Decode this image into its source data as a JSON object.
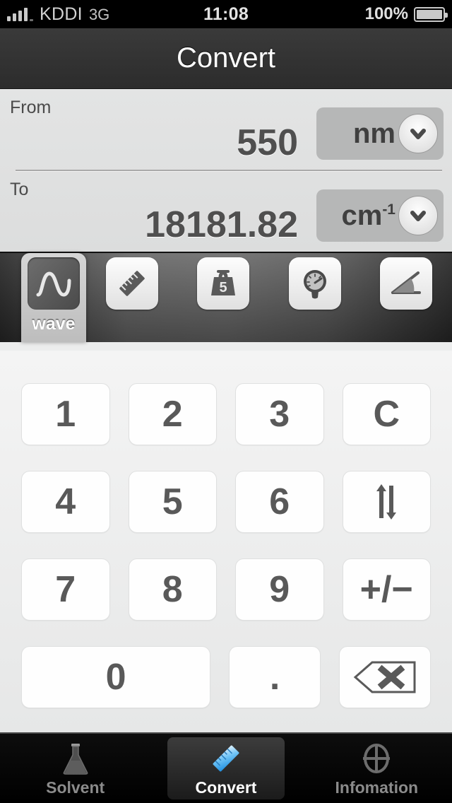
{
  "status_bar": {
    "carrier": "KDDI",
    "network": "3G",
    "time": "11:08",
    "battery_percent": "100%",
    "signal_icon": "signal-bars-icon",
    "battery_icon": "battery-full-icon"
  },
  "navbar": {
    "title": "Convert"
  },
  "converter": {
    "from": {
      "label": "From",
      "value": "550",
      "unit": "nm",
      "unit_superscript": "",
      "dropdown_icon": "chevron-down-icon"
    },
    "to": {
      "label": "To",
      "value": "18181.82",
      "unit": "cm",
      "unit_superscript": "-1",
      "dropdown_icon": "chevron-down-icon"
    }
  },
  "categories": {
    "selected": "wave",
    "items": [
      {
        "label": "wave",
        "icon": "sine-wave-icon",
        "selected": true
      },
      {
        "label": "length",
        "icon": "ruler-icon",
        "selected": false
      },
      {
        "label": "weight",
        "icon": "weight-5-icon",
        "selected": false
      },
      {
        "label": "pressure",
        "icon": "pressure-gauge-icon",
        "selected": false
      },
      {
        "label": "angle",
        "icon": "angle-icon",
        "selected": false
      }
    ]
  },
  "keypad": {
    "rows": [
      [
        {
          "label": "1",
          "name": "key-1",
          "icon": ""
        },
        {
          "label": "2",
          "name": "key-2",
          "icon": ""
        },
        {
          "label": "3",
          "name": "key-3",
          "icon": ""
        },
        {
          "label": "C",
          "name": "key-clear",
          "icon": ""
        }
      ],
      [
        {
          "label": "4",
          "name": "key-4",
          "icon": ""
        },
        {
          "label": "5",
          "name": "key-5",
          "icon": ""
        },
        {
          "label": "6",
          "name": "key-6",
          "icon": ""
        },
        {
          "label": "",
          "name": "key-swap",
          "icon": "swap-arrows-icon"
        }
      ],
      [
        {
          "label": "7",
          "name": "key-7",
          "icon": ""
        },
        {
          "label": "8",
          "name": "key-8",
          "icon": ""
        },
        {
          "label": "9",
          "name": "key-9",
          "icon": ""
        },
        {
          "label": "+/−",
          "name": "key-plus-minus",
          "icon": ""
        }
      ],
      [
        {
          "label": "0",
          "name": "key-0",
          "icon": ""
        },
        {
          "label": ".",
          "name": "key-decimal",
          "icon": ""
        },
        {
          "label": "",
          "name": "key-backspace",
          "icon": "backspace-icon"
        }
      ]
    ]
  },
  "tabbar": {
    "tabs": [
      {
        "label": "Solvent",
        "icon": "flask-icon",
        "active": false
      },
      {
        "label": "Convert",
        "icon": "blue-ruler-icon",
        "active": true
      },
      {
        "label": "Infomation",
        "icon": "crosshair-icon",
        "active": false
      }
    ]
  },
  "colors": {
    "accent_blue": "#3fa9f5",
    "navbar_bg": "#333333",
    "panel_bg": "#e0e1e1",
    "key_text": "#595959"
  }
}
